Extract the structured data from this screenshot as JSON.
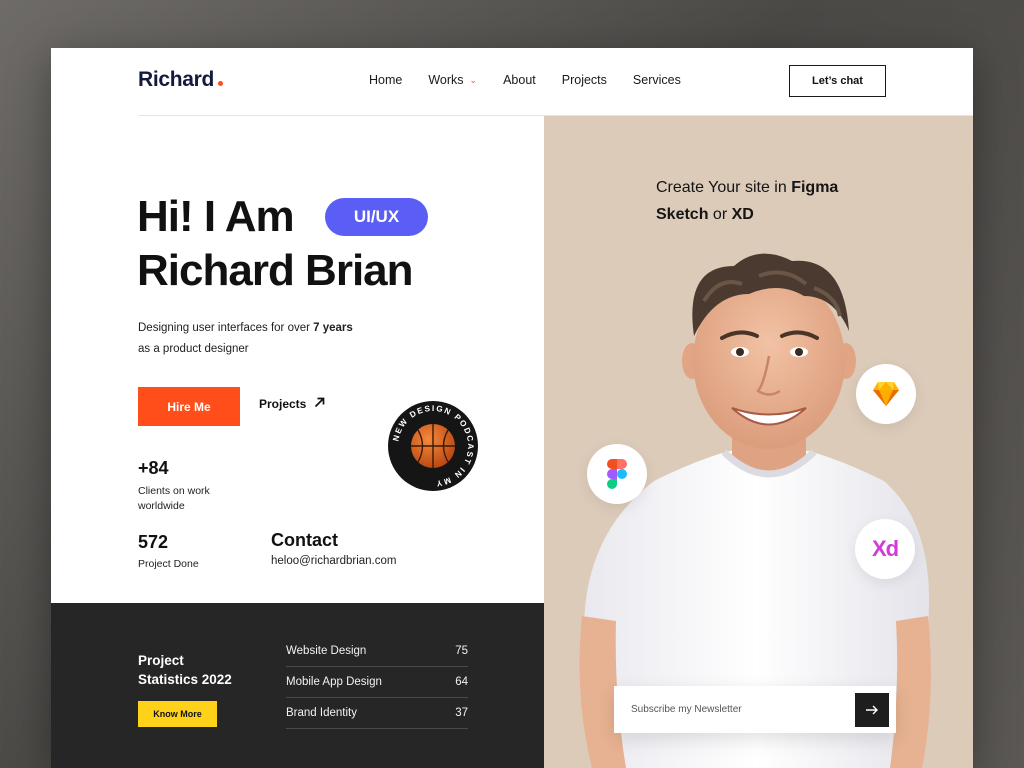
{
  "header": {
    "logo": "Richard",
    "nav": [
      {
        "label": "Home"
      },
      {
        "label": "Works"
      },
      {
        "label": "About"
      },
      {
        "label": "Projects"
      },
      {
        "label": "Services"
      }
    ],
    "cta": "Let’s chat"
  },
  "hero": {
    "line1": "Hi! I Am",
    "badge": "UI/UX",
    "line2": "Richard Brian",
    "subtitle_prefix": "Designing user interfaces for over",
    "subtitle_bold": "7 years",
    "subtitle_suffix": "as a product designer",
    "hire_button": "Hire Me",
    "projects_link": "Projects",
    "stamp_text": "NEW DESIGN PODCAST IN MY"
  },
  "stats": {
    "clients_value": "+84",
    "clients_label_1": "Clients on work",
    "clients_label_2": "worldwide",
    "projects_value": "572",
    "projects_label": "Project Done"
  },
  "contact": {
    "title": "Contact",
    "email": "heloo@richardbrian.com"
  },
  "project_stats": {
    "title_1": "Project",
    "title_2": "Statistics 2022",
    "button": "Know More",
    "rows": [
      {
        "name": "Website Design",
        "value": "75"
      },
      {
        "name": "Mobile App Design",
        "value": "64"
      },
      {
        "name": "Brand Identity",
        "value": "37"
      }
    ]
  },
  "right_panel": {
    "head_prefix": "Create Your site in",
    "head_figma": "Figma",
    "head_sketch": "Sketch",
    "head_or": "or",
    "head_xd": "XD",
    "tools": [
      "sketch-icon",
      "figma-icon",
      "adobe-xd-icon"
    ],
    "xd_glyph": "Xd",
    "newsletter_placeholder": "Subscribe my Newsletter"
  },
  "colors": {
    "accent": "#ff4e1a",
    "pill": "#5b5ef5",
    "yellow": "#ffd21a",
    "dark": "#262626",
    "panel": "#dccbb9",
    "logo": "#141a3d"
  }
}
